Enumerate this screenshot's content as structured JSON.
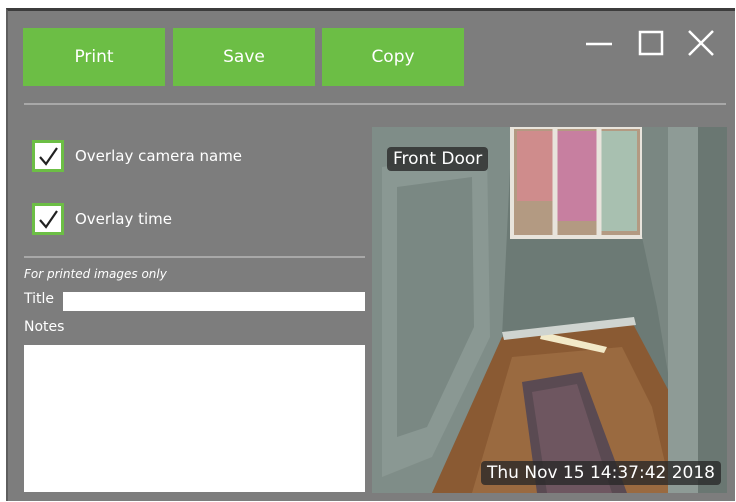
{
  "toolbar": {
    "print_label": "Print",
    "save_label": "Save",
    "copy_label": "Copy"
  },
  "window_controls": {
    "minimize_icon": "minimize-icon",
    "maximize_icon": "maximize-icon",
    "close_icon": "close-icon"
  },
  "options": {
    "overlay_camera_name": {
      "label": "Overlay camera name",
      "checked": true
    },
    "overlay_time": {
      "label": "Overlay time",
      "checked": true
    }
  },
  "print_fields": {
    "note": "For printed images only",
    "title_label": "Title",
    "title_value": "",
    "notes_label": "Notes",
    "notes_value": ""
  },
  "preview": {
    "camera_name": "Front Door",
    "timestamp": "Thu Nov 15 14:37:42 2018"
  },
  "colors": {
    "accent": "#6cbe45",
    "window_bg": "#7d7d7d",
    "text": "#ffffff"
  }
}
